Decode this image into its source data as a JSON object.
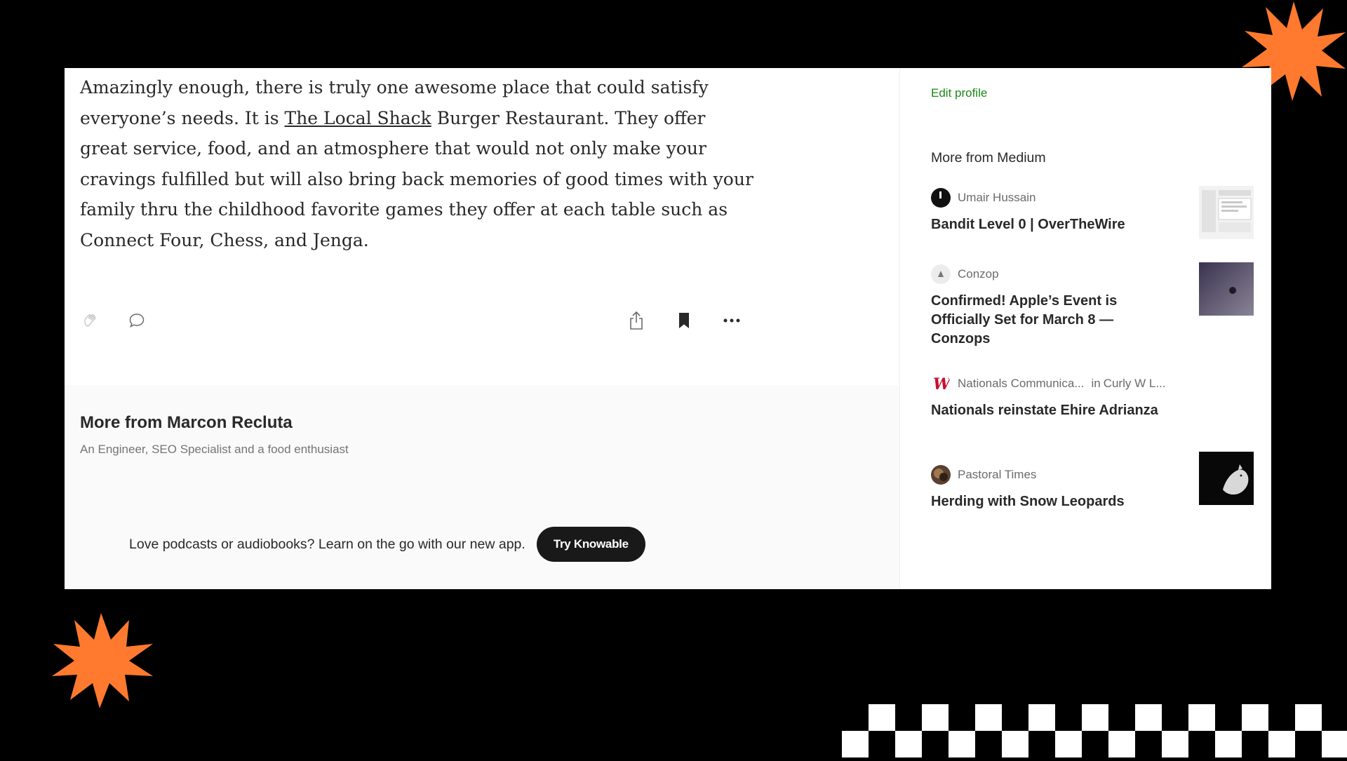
{
  "article": {
    "body_before_link": "Amazingly enough, there is truly one awesome place that could satisfy everyone’s needs. It is ",
    "link_text": "The Local Shack",
    "body_after_link": " Burger Restaurant. They offer great service, food, and an atmosphere that would not only make your cravings fulfilled but will also bring back memories of good times with your family thru the childhood favorite games they offer at each table such as Connect Four, Chess, and Jenga."
  },
  "actions": {
    "clap_icon": "clap-icon",
    "comment_icon": "comment-icon",
    "share_icon": "share-icon",
    "bookmark_icon": "bookmark-icon",
    "more_icon": "more-icon"
  },
  "more_from_author": {
    "title": "More from Marcon Recluta",
    "subtitle": "An Engineer, SEO Specialist and a food enthusiast"
  },
  "promo": {
    "text": "Love podcasts or audiobooks? Learn on the go with our new app.",
    "button_label": "Try Knowable"
  },
  "sidebar": {
    "edit_profile": "Edit profile",
    "heading": "More from Medium",
    "recommendations": [
      {
        "author": "Umair Hussain",
        "publication": "",
        "title": "Bandit Level 0 | OverTheWire"
      },
      {
        "author": "Conzop",
        "publication": "",
        "title": "Confirmed! Apple’s Event is Officially Set for March 8 — Conzops"
      },
      {
        "author": "Nationals Communica...",
        "in_label": "in",
        "publication": "Curly W L...",
        "title": "Nationals reinstate Ehire Adrianza"
      },
      {
        "author": "Pastoral Times",
        "publication": "",
        "title": "Herding with Snow Leopards"
      }
    ]
  },
  "colors": {
    "accent_green": "#1a8917",
    "burst_orange": "#ff7a2e",
    "background": "#000000"
  }
}
